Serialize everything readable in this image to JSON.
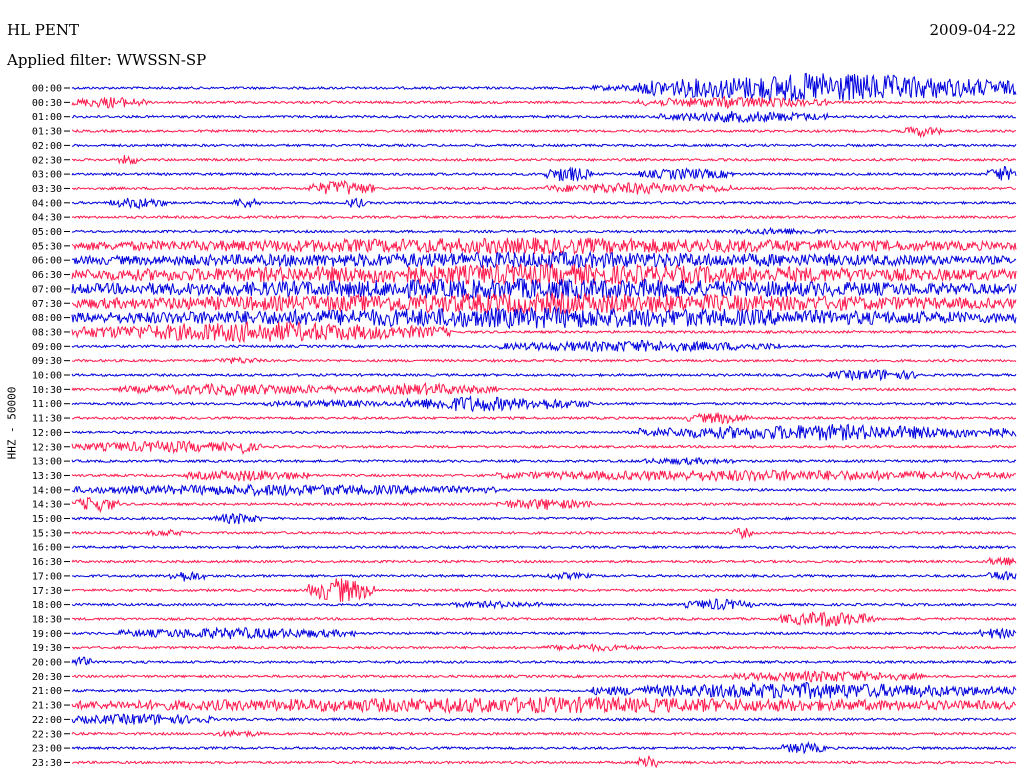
{
  "header": {
    "station": "HL PENT",
    "date": "2009-04-22",
    "filter": "Applied filter: WWSSN-SP"
  },
  "chart_data": {
    "type": "line",
    "title": "HL PENT",
    "ylabel": "HHZ - 50000",
    "colors": [
      "#0000dd",
      "#ff1a4d"
    ],
    "tick_labels": [
      "00:00",
      "00:30",
      "01:00",
      "01:30",
      "02:00",
      "02:30",
      "03:00",
      "03:30",
      "04:00",
      "04:30",
      "05:00",
      "05:30",
      "06:00",
      "06:30",
      "07:00",
      "07:30",
      "08:00",
      "08:30",
      "09:00",
      "09:30",
      "10:00",
      "10:30",
      "11:00",
      "11:30",
      "12:00",
      "12:30",
      "13:00",
      "13:30",
      "14:00",
      "14:30",
      "15:00",
      "15:30",
      "16:00",
      "16:30",
      "17:00",
      "17:30",
      "18:00",
      "18:30",
      "19:00",
      "19:30",
      "20:00",
      "20:30",
      "21:00",
      "21:30",
      "22:00",
      "22:30",
      "23:00",
      "23:30"
    ],
    "activity": [
      [
        [
          0.55,
          0.65,
          1
        ],
        [
          0.6,
          1.0,
          6
        ]
      ],
      [
        [
          0,
          0.08,
          2
        ],
        [
          0.6,
          0.8,
          2
        ]
      ],
      [
        [
          0.62,
          0.8,
          2
        ]
      ],
      [
        [
          0.88,
          0.92,
          2
        ]
      ],
      [],
      [
        [
          0.05,
          0.07,
          2
        ]
      ],
      [
        [
          0.5,
          0.55,
          3
        ],
        [
          0.6,
          0.7,
          2
        ],
        [
          0.97,
          1.0,
          3
        ]
      ],
      [
        [
          0.25,
          0.32,
          3
        ],
        [
          0.5,
          0.7,
          2
        ]
      ],
      [
        [
          0.04,
          0.1,
          2
        ],
        [
          0.17,
          0.2,
          2
        ],
        [
          0.29,
          0.31,
          2
        ]
      ],
      [],
      [
        [
          0.7,
          0.8,
          1
        ]
      ],
      [
        [
          0,
          1.0,
          3
        ]
      ],
      [
        [
          0,
          1.0,
          3
        ]
      ],
      [
        [
          0,
          1.0,
          4
        ]
      ],
      [
        [
          0,
          1.0,
          4
        ]
      ],
      [
        [
          0,
          1.0,
          4
        ]
      ],
      [
        [
          0,
          1.0,
          4
        ]
      ],
      [
        [
          0,
          0.4,
          4
        ]
      ],
      [
        [
          0.45,
          0.75,
          2
        ]
      ],
      [
        [
          0.15,
          0.2,
          1
        ]
      ],
      [
        [
          0.8,
          0.9,
          2
        ]
      ],
      [
        [
          0.05,
          0.3,
          2
        ],
        [
          0.3,
          0.45,
          2
        ]
      ],
      [
        [
          0.2,
          0.35,
          1
        ],
        [
          0.35,
          0.5,
          3
        ],
        [
          0.45,
          0.55,
          2
        ]
      ],
      [
        [
          0.65,
          0.72,
          2
        ]
      ],
      [
        [
          0.6,
          1.0,
          3
        ]
      ],
      [
        [
          0,
          0.2,
          2
        ],
        [
          0.17,
          0.19,
          3
        ]
      ],
      [
        [
          0.6,
          0.7,
          1
        ]
      ],
      [
        [
          0.12,
          0.25,
          2
        ],
        [
          0.45,
          1.0,
          2
        ]
      ],
      [
        [
          0,
          0.45,
          2
        ]
      ],
      [
        [
          0,
          0.05,
          3
        ],
        [
          0.45,
          0.55,
          2
        ]
      ],
      [
        [
          0.15,
          0.2,
          2
        ]
      ],
      [
        [
          0.08,
          0.12,
          1
        ],
        [
          0.7,
          0.72,
          2
        ]
      ],
      [],
      [
        [
          0.97,
          1.0,
          2
        ]
      ],
      [
        [
          0.1,
          0.14,
          2
        ],
        [
          0.5,
          0.55,
          1
        ],
        [
          0.97,
          1.0,
          2
        ]
      ],
      [
        [
          0.25,
          0.32,
          5
        ]
      ],
      [
        [
          0.4,
          0.5,
          1
        ],
        [
          0.65,
          0.72,
          2
        ]
      ],
      [
        [
          0.75,
          0.85,
          3
        ]
      ],
      [
        [
          0.05,
          0.3,
          2
        ],
        [
          0.96,
          1.0,
          2
        ]
      ],
      [
        [
          0.5,
          0.6,
          1
        ]
      ],
      [
        [
          0,
          0.02,
          2
        ]
      ],
      [
        [
          0.7,
          0.9,
          2
        ]
      ],
      [
        [
          0.55,
          1.0,
          3
        ]
      ],
      [
        [
          0,
          1.0,
          3
        ]
      ],
      [
        [
          0,
          0.15,
          2
        ]
      ],
      [
        [
          0.15,
          0.2,
          1
        ]
      ],
      [
        [
          0.75,
          0.8,
          2
        ]
      ],
      [
        [
          0.6,
          0.62,
          4
        ]
      ]
    ]
  }
}
